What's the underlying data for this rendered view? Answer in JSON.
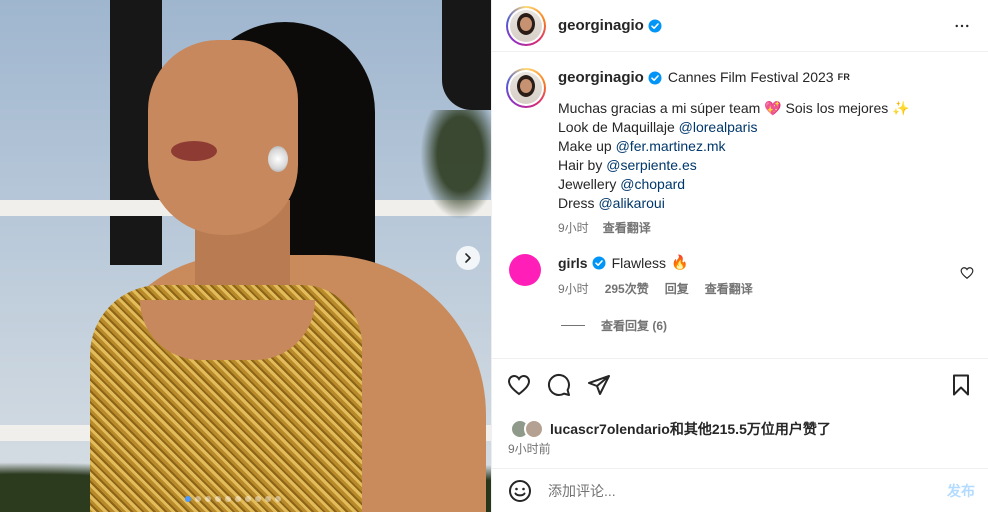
{
  "media": {
    "slide_count": 10,
    "active_slide": 1,
    "icons": {
      "next": "chevron-right-icon"
    }
  },
  "header": {
    "username": "georginagio",
    "verified": true,
    "icons": {
      "more": "more-horizontal-icon",
      "verified": "verified-badge-icon"
    }
  },
  "post": {
    "username": "georginagio",
    "location": "Cannes Film Festival 2023",
    "location_badge": "FR",
    "caption": {
      "line1_text": "Muchas gracias a mi súper team",
      "line1_emoji1": "💖",
      "line1_text2": "Sois los mejores",
      "line1_emoji2": "✨",
      "line2_prefix": "Look de Maquillaje",
      "line2_mention": "@lorealparis",
      "line3_prefix": "Make up",
      "line3_mention": "@fer.martinez.mk",
      "line4_prefix": "Hair by",
      "line4_mention": "@serpiente.es",
      "line5_prefix": "Jewellery",
      "line5_mention": "@chopard",
      "line6_prefix": "Dress",
      "line6_mention": "@alikaroui"
    },
    "time": "9小时",
    "translate": "查看翻译"
  },
  "comment": {
    "username": "girls",
    "verified": true,
    "text": "Flawless",
    "emoji": "🔥",
    "time": "9小时",
    "likes": "295次赞",
    "reply": "回复",
    "translate": "查看翻译",
    "view_replies": "查看回复 (6)",
    "icons": {
      "like": "heart-outline-icon"
    }
  },
  "actions": {
    "icons": [
      "heart-outline-icon",
      "comment-icon",
      "share-icon",
      "bookmark-icon"
    ]
  },
  "likes": {
    "text": "lucascr7olendario和其他215.5万位用户赞了"
  },
  "timestamp": "9小时前",
  "add_comment": {
    "placeholder": "添加评论...",
    "post_label": "发布",
    "icons": {
      "emoji": "emoji-smile-icon"
    }
  },
  "colors": {
    "accent_blue": "#0095f6",
    "link_blue": "#00376b",
    "muted_gray": "#737373",
    "post_disabled": "#b3dbff",
    "comment_avatar": "#ff1fb8"
  }
}
